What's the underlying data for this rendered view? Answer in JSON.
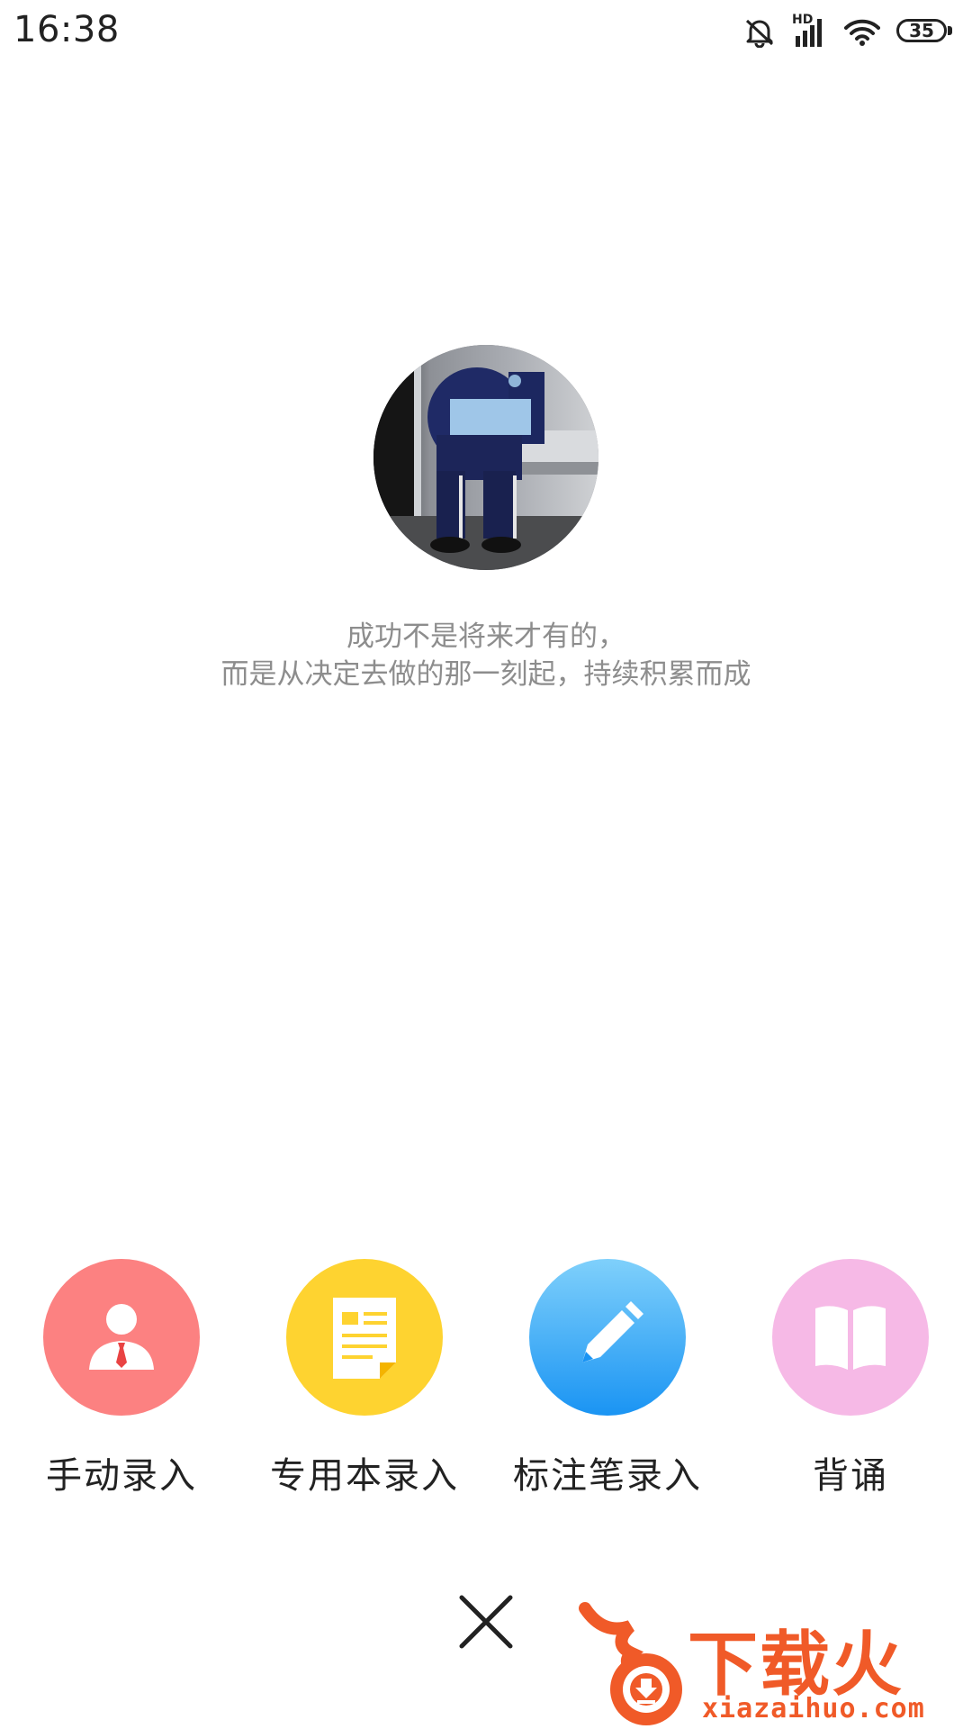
{
  "status_bar": {
    "time": "16:38",
    "network_label": "HD",
    "battery_level": "35",
    "icons": [
      "mute-icon",
      "signal-icon",
      "wifi-icon",
      "battery-icon"
    ]
  },
  "avatar": {
    "icon": "avatar-photo"
  },
  "quote": {
    "line1": "成功不是将来才有的，",
    "line2": "而是从决定去做的那一刻起，持续积累而成"
  },
  "actions": [
    {
      "label": "手动录入",
      "icon": "person-icon",
      "color": "#fc8181"
    },
    {
      "label": "专用本录入",
      "icon": "document-icon",
      "color": "#fed330"
    },
    {
      "label": "标注笔录入",
      "icon": "pencil-icon",
      "color": "#33a6f8"
    },
    {
      "label": "背诵",
      "icon": "book-icon",
      "color": "#f6b9e6"
    }
  ],
  "close": {
    "icon": "close-icon"
  },
  "watermark": {
    "brand": "下载火",
    "url": "xiazaihuo.com",
    "color": "#f05a28"
  }
}
